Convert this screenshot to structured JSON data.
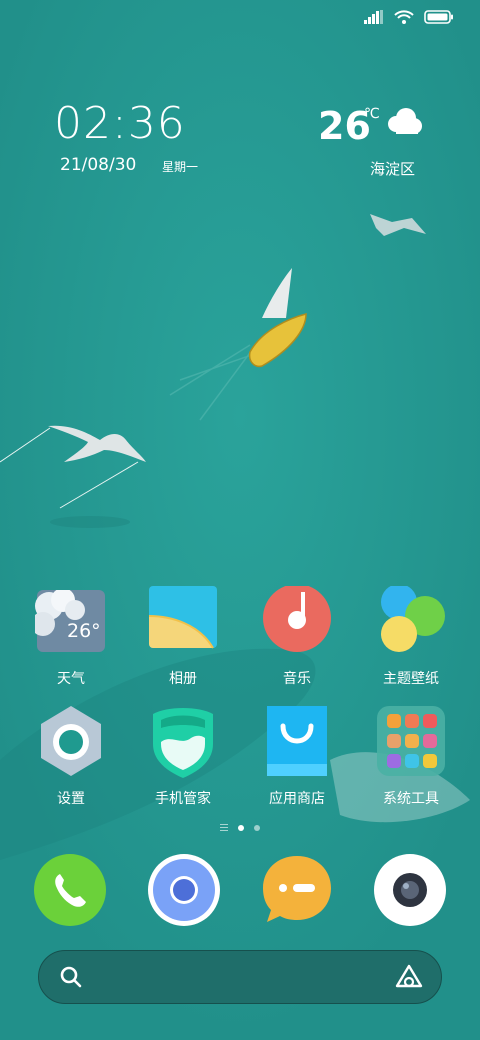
{
  "clock": {
    "time": "02:36",
    "date": "21/08/30",
    "weekday": "星期一"
  },
  "weather": {
    "temperature": "26",
    "unit": "℃",
    "location": "海淀区",
    "condition_icon": "cloud-icon"
  },
  "apps": [
    {
      "label": "天气",
      "icon": "weather-app-icon",
      "icon_text": "26°"
    },
    {
      "label": "相册",
      "icon": "gallery-app-icon"
    },
    {
      "label": "音乐",
      "icon": "music-app-icon"
    },
    {
      "label": "主题壁纸",
      "icon": "themes-app-icon"
    },
    {
      "label": "设置",
      "icon": "settings-app-icon"
    },
    {
      "label": "手机管家",
      "icon": "security-app-icon"
    },
    {
      "label": "应用商店",
      "icon": "app-store-icon"
    },
    {
      "label": "系统工具",
      "icon": "system-tools-folder-icon"
    }
  ],
  "dock": [
    {
      "name": "phone-app",
      "icon": "phone-icon"
    },
    {
      "name": "browser-app",
      "icon": "browser-icon"
    },
    {
      "name": "messages-app",
      "icon": "messages-icon"
    },
    {
      "name": "camera-app",
      "icon": "camera-icon"
    }
  ],
  "pager": {
    "pages": 2,
    "current": 1
  },
  "colors": {
    "background": "#25968f",
    "search_bar": "#1f6e6a"
  }
}
